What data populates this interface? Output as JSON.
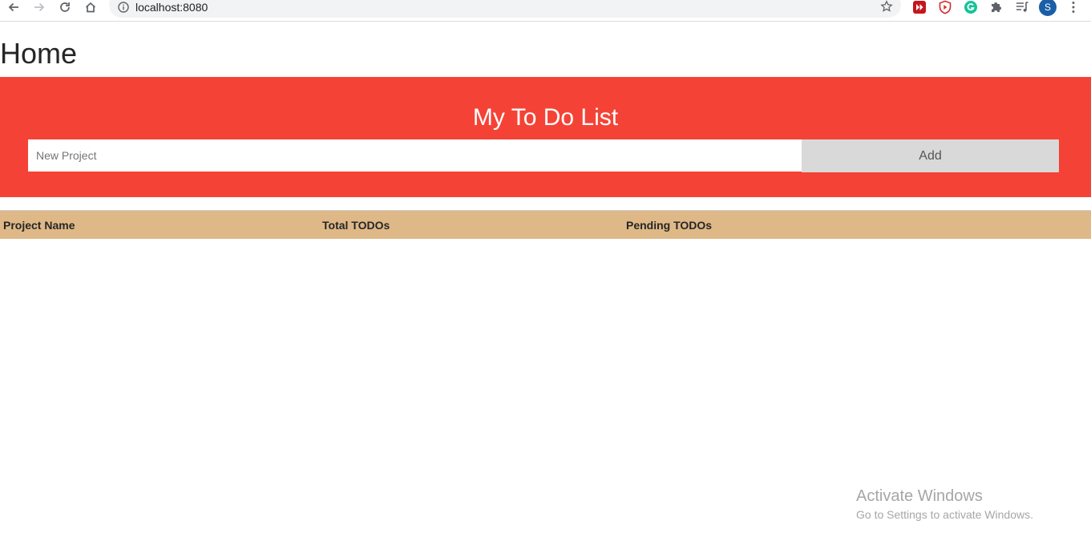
{
  "browser": {
    "url": "localhost:8080",
    "profile_initial": "S",
    "icons": [
      "back-arrow-icon",
      "forward-arrow-icon",
      "reload-icon",
      "home-icon",
      "info-icon",
      "star-icon",
      "video-extension-icon",
      "shield-play-extension-icon",
      "grammarly-icon",
      "puzzle-extensions-icon",
      "media-queue-icon",
      "more-vert-icon"
    ]
  },
  "page": {
    "title": "Home"
  },
  "todo": {
    "heading": "My To Do List",
    "input_placeholder": "New Project",
    "input_value": "",
    "add_label": "Add"
  },
  "table": {
    "columns": [
      "Project Name",
      "Total TODOs",
      "Pending TODOs"
    ],
    "rows": []
  },
  "watermark": {
    "title": "Activate Windows",
    "subtitle": "Go to Settings to activate Windows."
  },
  "colors": {
    "hero_background": "#f44336",
    "table_header_background": "#dfb887",
    "add_button_background": "#d9d9d9"
  }
}
